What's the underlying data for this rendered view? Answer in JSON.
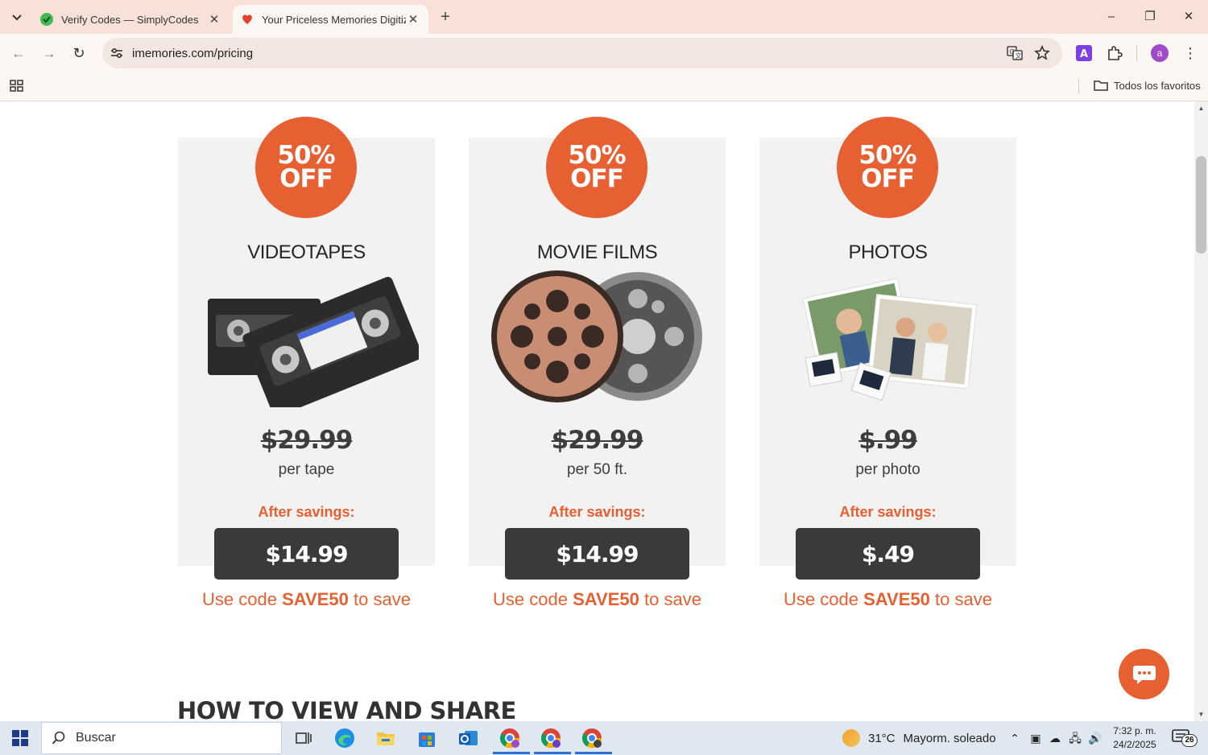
{
  "browser": {
    "tabs": [
      {
        "title": "Verify Codes — SimplyCodes",
        "active": false
      },
      {
        "title": "Your Priceless Memories Digitiz",
        "active": true
      }
    ],
    "url": "imemories.com/pricing",
    "bookmarks_folder": "Todos los favoritos",
    "profile_initial": "a"
  },
  "page": {
    "cards": [
      {
        "badge_line1": "50%",
        "badge_line2": "OFF",
        "title": "VIDEOTAPES",
        "old_price": "$29.99",
        "unit": "per tape",
        "after_label": "After savings:",
        "new_price": "$14.99",
        "code_prefix": "Use code",
        "code": "SAVE50",
        "code_suffix": "to save",
        "image": "vhs-tapes"
      },
      {
        "badge_line1": "50%",
        "badge_line2": "OFF",
        "title": "MOVIE FILMS",
        "old_price": "$29.99",
        "unit": "per 50 ft.",
        "after_label": "After savings:",
        "new_price": "$14.99",
        "code_prefix": "Use code",
        "code": "SAVE50",
        "code_suffix": "to save",
        "image": "film-reels"
      },
      {
        "badge_line1": "50%",
        "badge_line2": "OFF",
        "title": "PHOTOS",
        "old_price": "$.99",
        "unit": "per photo",
        "after_label": "After savings:",
        "new_price": "$.49",
        "code_prefix": "Use code",
        "code": "SAVE50",
        "code_suffix": "to save",
        "image": "photo-prints"
      }
    ],
    "section_heading": "HOW TO VIEW AND SHARE",
    "colors": {
      "accent": "#e66031",
      "price_button": "#3a3a3a",
      "card_bg": "#f2f2f2"
    }
  },
  "taskbar": {
    "search_placeholder": "Buscar",
    "weather_temp": "31°C",
    "weather_desc": "Mayorm. soleado",
    "time": "7:32 p. m.",
    "date": "24/2/2025",
    "notifications": "26"
  }
}
